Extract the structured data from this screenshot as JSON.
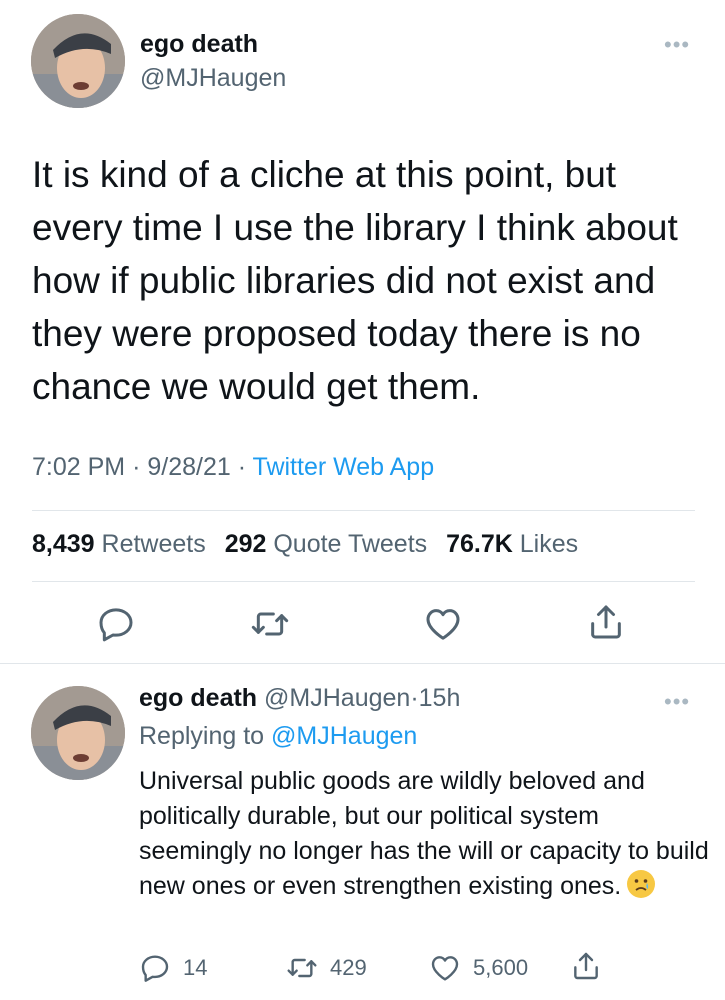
{
  "main_tweet": {
    "display_name": "ego death",
    "handle": "@MJHaugen",
    "more_icon": "more-dots-icon",
    "text": "It is kind of a cliche at this point, but every time I use the library I think about how if public libraries did not exist and they were proposed today there is no chance we would get them.",
    "time": "7:02 PM",
    "date": "9/28/21",
    "dot": "·",
    "source": "Twitter Web App",
    "stats": {
      "retweets_count": "8,439",
      "retweets_label": "Retweets",
      "quotes_count": "292",
      "quotes_label": "Quote Tweets",
      "likes_count": "76.7K",
      "likes_label": "Likes"
    },
    "actions": [
      "reply-icon",
      "retweet-icon",
      "like-icon",
      "share-icon"
    ]
  },
  "reply_tweet": {
    "display_name": "ego death",
    "handle": "@MJHaugen",
    "dot": "·",
    "age": "15h",
    "replying_prefix": "Replying to",
    "replying_handle": "@MJHaugen",
    "text": "Universal public goods are wildly beloved and politically durable, but our political system seemingly no longer has the will or capacity to build new ones or even strengthen existing ones.",
    "emoji": "crying-face-emoji",
    "actions": {
      "reply_count": "14",
      "retweet_count": "429",
      "like_count": "5,600"
    }
  },
  "colors": {
    "text": "#0f1419",
    "secondary": "#536471",
    "link": "#1d9bf0",
    "divider": "#e1e6ea"
  }
}
